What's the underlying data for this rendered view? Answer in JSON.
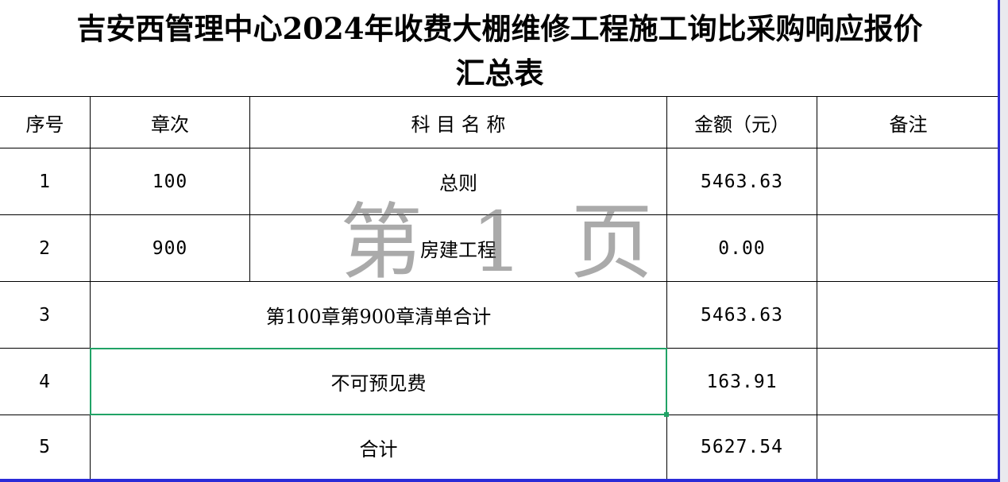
{
  "title": {
    "line1": "吉安西管理中心2024年收费大棚维修工程施工询比采购响应报价",
    "line2": "汇总表"
  },
  "table": {
    "headers": {
      "seq": "序号",
      "chapter": "章次",
      "subject": "科 目 名 称",
      "amount": "金额（元）",
      "remark": "备注"
    },
    "rows": [
      {
        "seq": "1",
        "chapter": "100",
        "subject": "总则",
        "amount": "5463.63",
        "remark": ""
      },
      {
        "seq": "2",
        "chapter": "900",
        "subject": "房建工程",
        "amount": "0.00",
        "remark": ""
      },
      {
        "seq": "3",
        "merged": "第100章第900章清单合计",
        "amount": "5463.63",
        "remark": ""
      },
      {
        "seq": "4",
        "merged": "不可预见费",
        "amount": "163.91",
        "remark": ""
      },
      {
        "seq": "5",
        "merged": "合计",
        "amount": "5627.54",
        "remark": ""
      }
    ]
  },
  "watermark": {
    "char1": "第",
    "char2": "1",
    "char3": "页"
  },
  "colors": {
    "selection": "#21a366",
    "window_border": "#2b2bd8",
    "grid": "#000000"
  }
}
